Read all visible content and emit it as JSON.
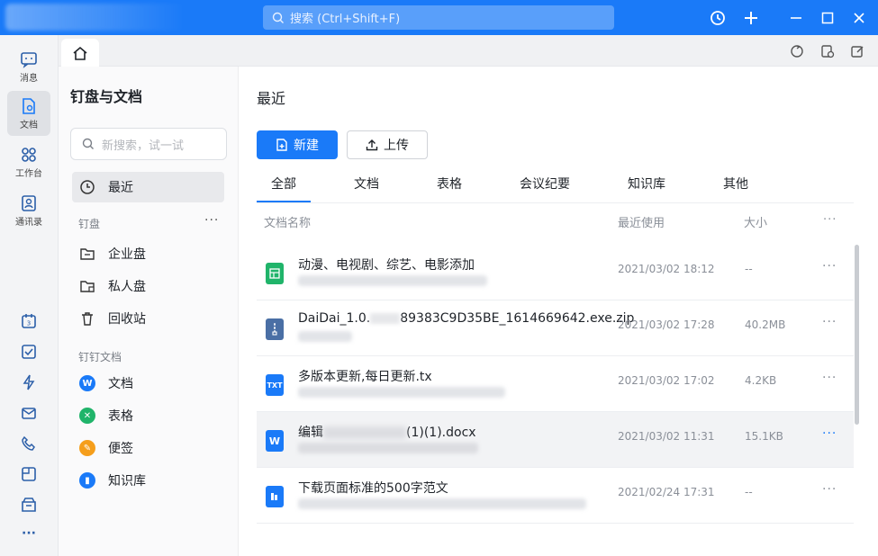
{
  "titlebar": {
    "search_placeholder": "搜索 (Ctrl+Shift+F)"
  },
  "rail": {
    "items": [
      {
        "label": "消息"
      },
      {
        "label": "文档"
      },
      {
        "label": "工作台"
      },
      {
        "label": "通讯录"
      }
    ],
    "more": "···"
  },
  "sidebar": {
    "title": "钉盘与文档",
    "search_placeholder": "新搜索，试一试",
    "recent_label": "最近",
    "section_drive": "钉盘",
    "section_more": "···",
    "drive_items": [
      {
        "label": "企业盘"
      },
      {
        "label": "私人盘"
      },
      {
        "label": "回收站"
      }
    ],
    "section_docs": "钉钉文档",
    "doc_items": [
      {
        "label": "文档",
        "color": "#1a7af8"
      },
      {
        "label": "表格",
        "color": "#20b46a"
      },
      {
        "label": "便签",
        "color": "#f59e1b"
      },
      {
        "label": "知识库",
        "color": "#1a7af8"
      }
    ]
  },
  "main": {
    "title": "最近",
    "new_button": "新建",
    "upload_button": "上传",
    "tabs": [
      "全部",
      "文档",
      "表格",
      "会议纪要",
      "知识库",
      "其他"
    ],
    "columns": {
      "name": "文档名称",
      "last_used": "最近使用",
      "size": "大小",
      "more": "···"
    },
    "files": [
      {
        "name": "动漫、电视剧、综艺、电影添加",
        "date": "2021/03/02 18:12",
        "size": "--",
        "icon": "sheet-icon",
        "more": "···"
      },
      {
        "name": "DaiDai_1.0.",
        "name_tail": "89383C9D35BE_1614669642.exe.zip",
        "date": "2021/03/02 17:28",
        "size": "40.2MB",
        "icon": "zip-icon",
        "more": "···"
      },
      {
        "name": "多版本更新,每日更新.tx",
        "date": "2021/03/02 17:02",
        "size": "4.2KB",
        "icon": "txt-icon",
        "more": "···"
      },
      {
        "name": "编辑",
        "name_tail": "(1)(1).docx",
        "date": "2021/03/02 11:31",
        "size": "15.1KB",
        "icon": "word-icon",
        "more": "···"
      },
      {
        "name": "下载页面标准的500字范文",
        "date": "2021/02/24 17:31",
        "size": "--",
        "icon": "doc-icon",
        "more": "···"
      }
    ]
  },
  "colors": {
    "accent": "#1a7af8",
    "sheet": "#20b46a",
    "zip": "#4a6fa5",
    "word": "#1a7af8"
  }
}
